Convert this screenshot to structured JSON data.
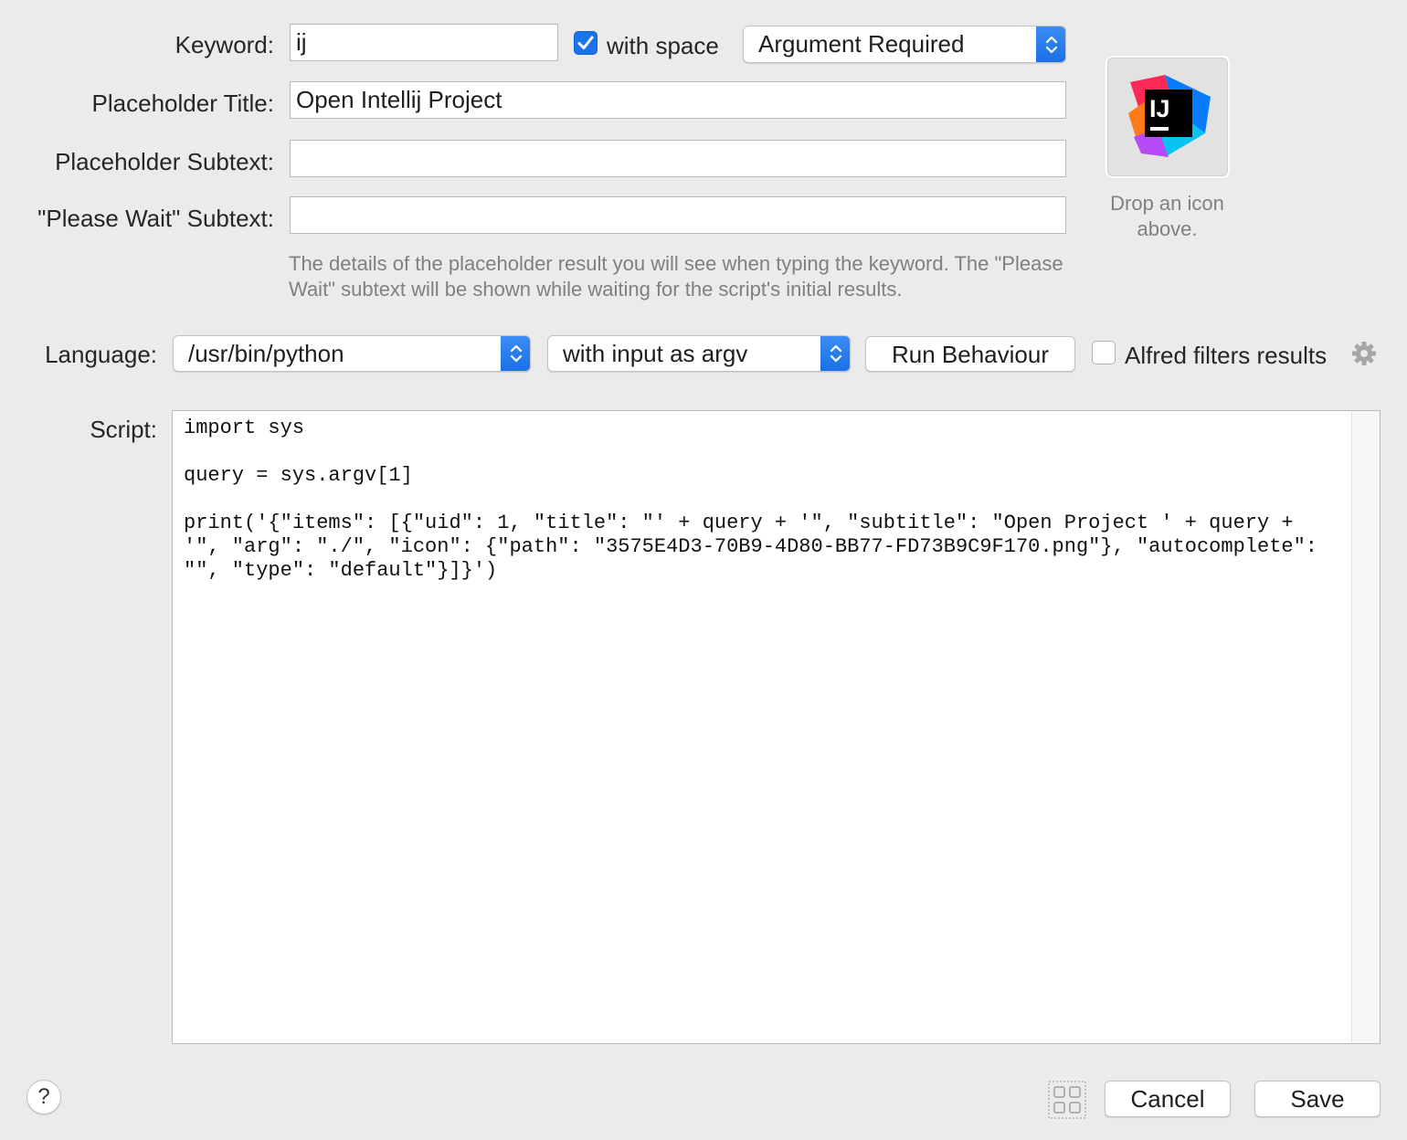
{
  "keyword": {
    "label": "Keyword:",
    "value": "ij",
    "with_space_label": "with space",
    "with_space_checked": true,
    "argument_mode": "Argument Required"
  },
  "placeholder_title": {
    "label": "Placeholder Title:",
    "value": "Open Intellij Project"
  },
  "placeholder_subtext": {
    "label": "Placeholder Subtext:",
    "value": ""
  },
  "please_wait_subtext": {
    "label": "\"Please Wait\" Subtext:",
    "value": ""
  },
  "hint_text": "The details of the placeholder result you will see when typing the keyword. The \"Please Wait\" subtext will be shown while waiting for the script's initial results.",
  "icon_well": {
    "icon_name": "intellij-idea-icon",
    "icon_text": "IJ",
    "drop_hint": "Drop an icon above."
  },
  "language": {
    "label": "Language:",
    "interpreter": "/usr/bin/python",
    "input_mode": "with input as argv",
    "run_behaviour_label": "Run Behaviour",
    "alfred_filters_label": "Alfred filters results",
    "alfred_filters_checked": false
  },
  "script": {
    "label": "Script:",
    "code": "import sys\n\nquery = sys.argv[1]\n\nprint('{\"items\": [{\"uid\": 1, \"title\": \"' + query + '\", \"subtitle\": \"Open Project ' + query + '\", \"arg\": \"./\", \"icon\": {\"path\": \"3575E4D3-70B9-4D80-BB77-FD73B9C9F170.png\"}, \"autocomplete\": \"\", \"type\": \"default\"}]}')"
  },
  "footer": {
    "help_label": "?",
    "cancel_label": "Cancel",
    "save_label": "Save"
  },
  "colors": {
    "accent": "#1a6fe3",
    "background": "#ebebeb"
  }
}
